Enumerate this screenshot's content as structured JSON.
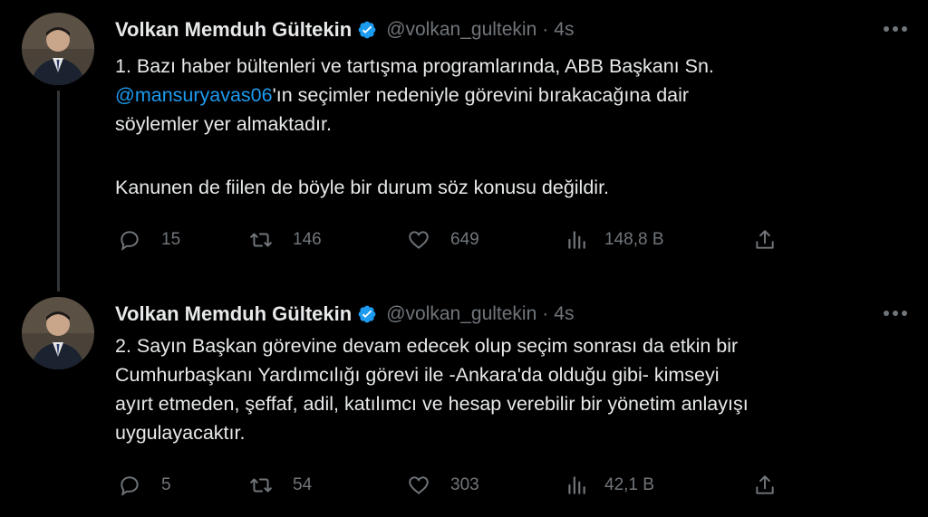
{
  "colors": {
    "background": "#000000",
    "primary_text": "#e7e9ea",
    "secondary_text": "#71767b",
    "link": "#1d9bf0",
    "verified_badge": "#1d9bf0",
    "thread_line": "#333639"
  },
  "tweets": [
    {
      "author_name": "Volkan Memduh Gültekin",
      "handle": "@volkan_gultekin",
      "separator": "·",
      "time": "4s",
      "verified_icon": "verified-badge-icon",
      "avatar_icon": "user-avatar",
      "body_lines": {
        "l1": "1. Bazı haber bültenleri ve tartışma programlarında, ABB Başkanı Sn.",
        "l2_mention": "@mansuryavas06",
        "l2_rest": "'ın seçimler nedeniyle görevini bırakacağına dair",
        "l3": "söylemler yer almaktadır.",
        "l4": "Kanunen de fiilen de böyle bir durum söz konusu değildir."
      },
      "actions": {
        "replies": "15",
        "retweets": "146",
        "likes": "649",
        "views": "148,8 B"
      }
    },
    {
      "author_name": "Volkan Memduh Gültekin",
      "handle": "@volkan_gultekin",
      "separator": "·",
      "time": "4s",
      "verified_icon": "verified-badge-icon",
      "avatar_icon": "user-avatar",
      "body_lines": {
        "l1": "2. Sayın Başkan görevine devam edecek olup seçim sonrası da etkin bir",
        "l2": "Cumhurbaşkanı Yardımcılığı görevi ile -Ankara'da olduğu gibi- kimseyi",
        "l3": "ayırt etmeden, şeffaf, adil, katılımcı ve hesap verebilir bir yönetim anlayışı",
        "l4": "uygulayacaktır."
      },
      "actions": {
        "replies": "5",
        "retweets": "54",
        "likes": "303",
        "views": "42,1 B"
      }
    }
  ],
  "icons": {
    "reply": "reply-icon",
    "retweet": "retweet-icon",
    "like": "heart-icon",
    "views": "views-icon",
    "share": "share-icon",
    "more": "more-icon"
  }
}
